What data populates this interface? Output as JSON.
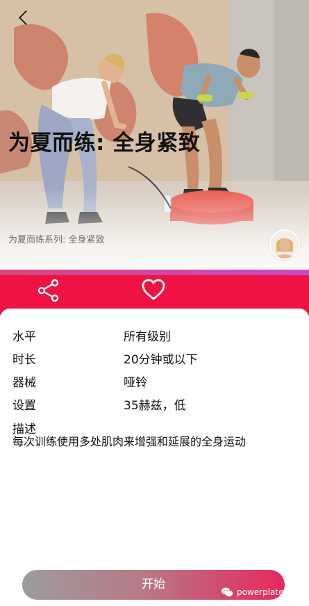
{
  "header": {
    "back_icon": "back-chevron-icon",
    "title": "为夏而练: 全身紧致",
    "series": "为夏而练系列: 全身紧致"
  },
  "actions": {
    "share_icon": "share-icon",
    "favorite_icon": "heart-icon",
    "bar_color": "#ee1245"
  },
  "details": [
    {
      "label": "水平",
      "value": "所有级别"
    },
    {
      "label": "时长",
      "value": "20分钟或以下"
    },
    {
      "label": "器械",
      "value": "哑铃"
    },
    {
      "label": "设置",
      "value": "35赫兹，低"
    }
  ],
  "description": {
    "label": "描述",
    "text": "每次训练使用多处肌肉来增强和延展的全身运动"
  },
  "start_button": {
    "label": "开始"
  },
  "watermark": {
    "text": "powerplatechina",
    "icon": "wechat-icon"
  }
}
